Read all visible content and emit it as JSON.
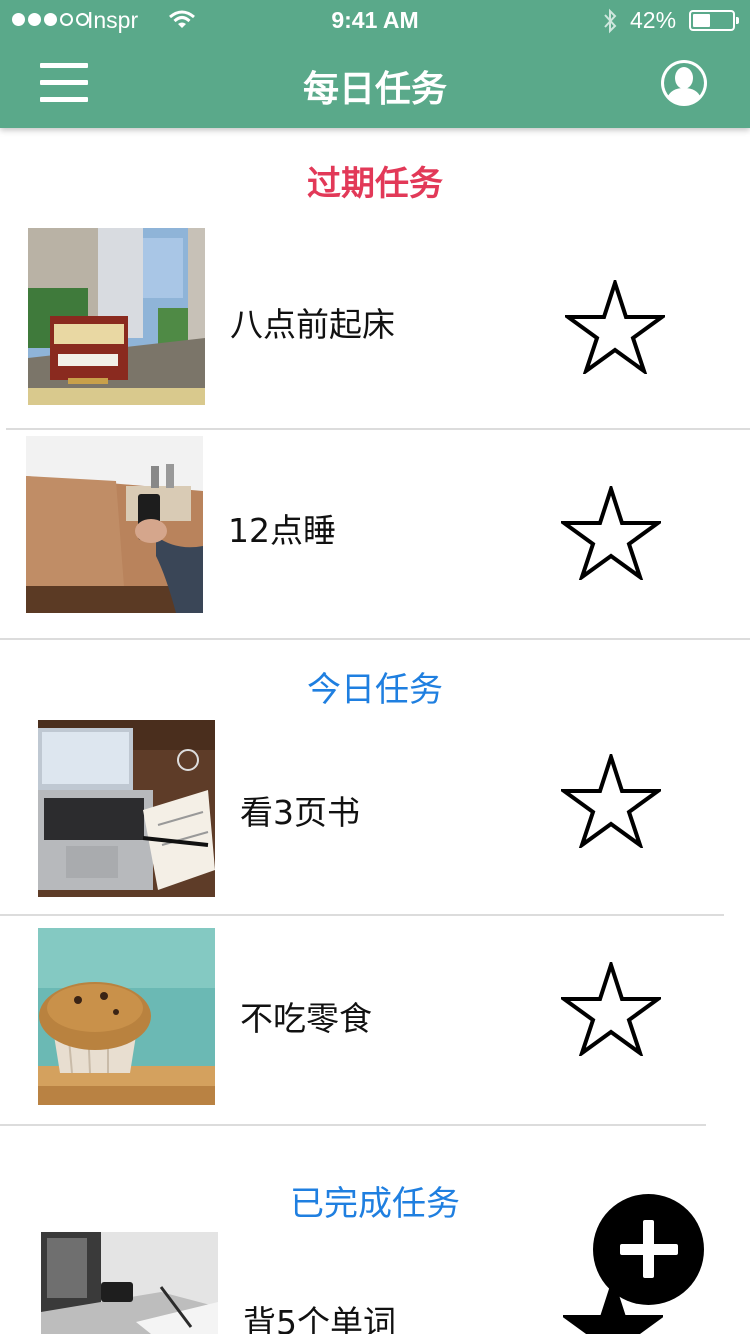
{
  "status_bar": {
    "carrier": "Inspr",
    "time": "9:41 AM",
    "battery": "42%",
    "battery_level": 0.42,
    "signal_bars_filled": 3,
    "signal_bars_total": 5
  },
  "nav": {
    "title": "每日任务",
    "menu_icon": "hamburger-menu-icon",
    "profile_icon": "user-avatar-icon",
    "color": "#5aa98a"
  },
  "sections": {
    "overdue": {
      "title": "过期任务",
      "color": "#e23958"
    },
    "today": {
      "title": "今日任务",
      "color": "#1f7fe0"
    },
    "done": {
      "title": "已完成任务",
      "color": "#1f7fe0"
    }
  },
  "tasks": {
    "overdue": [
      {
        "label": "八点前起床",
        "image": "cable-car-street-photo",
        "starred": false
      },
      {
        "label": "12点睡",
        "image": "hand-holding-phone-on-table-photo",
        "starred": false
      }
    ],
    "today": [
      {
        "label": "看3页书",
        "image": "laptop-and-notebook-on-desk-photo",
        "starred": false
      },
      {
        "label": "不吃零食",
        "image": "muffin-photo",
        "starred": false
      }
    ],
    "done": [
      {
        "label": "背5个单词",
        "image": "laptop-and-phone-black-white-photo",
        "starred": true
      }
    ]
  },
  "fab": {
    "icon": "plus-icon"
  }
}
